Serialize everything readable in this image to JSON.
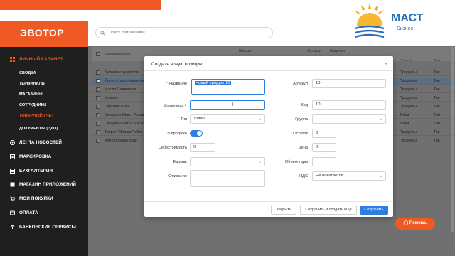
{
  "brand": {
    "name": "ЭВОТОР"
  },
  "search": {
    "placeholder": "Поиск приложений"
  },
  "sidebar": {
    "items": [
      {
        "label": "Личный кабинет",
        "icon": "dashboard-icon"
      },
      {
        "label": "Лента новостей",
        "icon": "news-icon"
      },
      {
        "label": "Маркировка",
        "icon": "tag-icon"
      },
      {
        "label": "Бухгалтерия",
        "icon": "calculator-icon"
      },
      {
        "label": "Магазин приложений",
        "icon": "store-icon"
      },
      {
        "label": "Мои покупки",
        "icon": "cart-icon"
      },
      {
        "label": "Оплата",
        "icon": "card-icon"
      },
      {
        "label": "Банковские сервисы",
        "icon": "bank-icon"
      }
    ],
    "subitems": [
      {
        "label": "Сводка"
      },
      {
        "label": "Терминалы"
      },
      {
        "label": "Магазины"
      },
      {
        "label": "Сотрудники"
      },
      {
        "label": "Товарный учет",
        "active": true
      },
      {
        "label": "Документы (ЭДО)"
      }
    ]
  },
  "table": {
    "headers": {
      "name": "Наименование",
      "store": "Магази",
      "rest": "Остатки",
      "markup": "Наценка",
      "group": "Группа",
      "type": "Тип"
    },
    "rows": [
      {
        "name": "Булочка с кунжутом",
        "group": "Продукты",
        "type": "Тов"
      },
      {
        "name": "Йогурт с наполнителем",
        "group": "Продукты",
        "type": "Тов",
        "selected": true
      },
      {
        "name": "Масло Сливочное",
        "group": "Продукты",
        "type": "Тов"
      },
      {
        "name": "Молоко",
        "group": "Продукты",
        "type": "Тов"
      },
      {
        "name": "Пирожок в асс.",
        "group": "Продукты",
        "type": "Тов"
      },
      {
        "name": "Сигареты Невст Розов",
        "group": "Табак",
        "type": "Таб"
      },
      {
        "name": "Сигареты Петр 1 Особ",
        "group": "Табак",
        "type": "Таб"
      },
      {
        "name": "Творог \"Милава\" обез",
        "group": "Продукты",
        "type": "Тов"
      },
      {
        "name": "Хлеб бородинский",
        "group": "Продукты",
        "type": "Тов"
      }
    ]
  },
  "modal": {
    "title": "Создать новую позицию",
    "fields": {
      "name_label": "Название",
      "name_value": "Новый продукт 10",
      "article_label": "Артикул",
      "article_value": "10",
      "barcode_label": "Штрих-код",
      "barcode_value": "",
      "code_label": "Код",
      "code_value": "10",
      "type_label": "Тип",
      "type_value": "Товар",
      "group_label": "Группа",
      "group_value": "",
      "sale_label": "В продаже",
      "rest_label": "Остаток",
      "rest_value": "0",
      "cost_label": "Себестоимость",
      "cost_value": "0",
      "price_label": "Цена",
      "price_value": "0",
      "unit_label": "Ед.изм.",
      "unit_value": "",
      "volume_label": "Объем тары",
      "volume_value": "",
      "desc_label": "Описание",
      "desc_value": "",
      "vat_label": "НДС",
      "vat_value": "Не облагается"
    },
    "buttons": {
      "close": "Закрыть",
      "save_more": "Сохранить и создать ещё",
      "save": "Сохранить"
    }
  },
  "help": {
    "label": "Помощь"
  },
  "logo": {
    "text": "МАСТ",
    "subtext": "Бизнес"
  },
  "colors": {
    "accent": "#ef5a24",
    "primary": "#2f7de1",
    "sidebar": "#1f1f1f"
  }
}
